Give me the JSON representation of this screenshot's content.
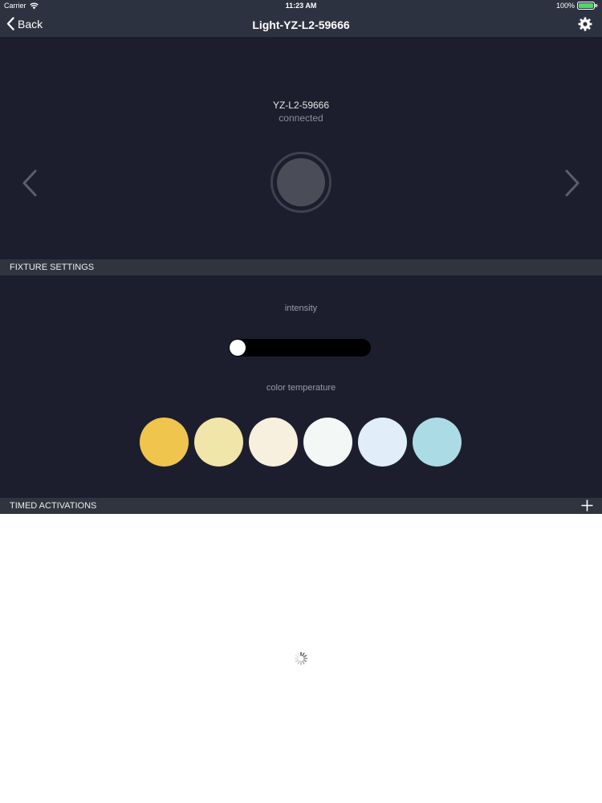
{
  "status_bar": {
    "carrier": "Carrier",
    "time": "11:23 AM",
    "battery": "100%"
  },
  "nav": {
    "back_label": "Back",
    "title": "Light-YZ-L2-59666"
  },
  "device": {
    "name": "YZ-L2-59666",
    "status": "connected"
  },
  "fixture_settings": {
    "header": "FIXTURE SETTINGS",
    "intensity_label": "intensity",
    "intensity_value": 0,
    "color_temperature_label": "color temperature",
    "swatches": [
      "#efc54d",
      "#f1e6a9",
      "#f7f0df",
      "#f3f8f6",
      "#e1eefa",
      "#abdce6"
    ]
  },
  "timed_activations": {
    "header": "TIMED ACTIVATIONS"
  },
  "icons": {
    "wifi": "wifi-icon",
    "battery": "battery-icon",
    "back": "chevron-left-icon",
    "settings": "gear-icon",
    "prev": "chevron-left-icon",
    "next": "chevron-right-icon",
    "add": "plus-icon",
    "loading": "spinner-icon"
  }
}
